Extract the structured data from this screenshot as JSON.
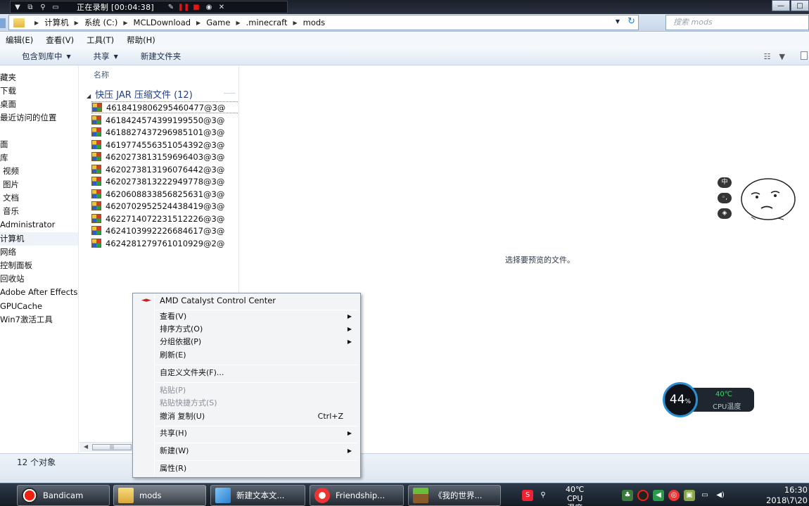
{
  "recorder": {
    "status_title": "正在录制 [00:04:38]"
  },
  "address_bar": {
    "crumbs": [
      "计算机",
      "系统 (C:)",
      "MCLDownload",
      "Game",
      ".minecraft",
      "mods"
    ],
    "search_placeholder": "搜索 mods"
  },
  "menu": {
    "items": [
      "编辑(E)",
      "查看(V)",
      "工具(T)",
      "帮助(H)"
    ]
  },
  "toolbar": {
    "include_library": "包含到库中",
    "share": "共享",
    "new_folder": "新建文件夹"
  },
  "nav": {
    "items": [
      {
        "label": "藏夹"
      },
      {
        "label": "下载"
      },
      {
        "label": "桌面"
      },
      {
        "label": "最近访问的位置"
      },
      {
        "label": ""
      },
      {
        "label": "面"
      },
      {
        "label": "库"
      },
      {
        "label": "视频"
      },
      {
        "label": "图片"
      },
      {
        "label": "文档"
      },
      {
        "label": "音乐"
      },
      {
        "label": "Administrator"
      },
      {
        "label": "计算机"
      },
      {
        "label": "网络"
      },
      {
        "label": "控制面板"
      },
      {
        "label": "回收站"
      },
      {
        "label": "Adobe After Effects"
      },
      {
        "label": "GPUCache"
      },
      {
        "label": "Win7激活工具"
      }
    ]
  },
  "file_list": {
    "column_name": "名称",
    "group_label": "快压 JAR 压缩文件 (12)",
    "files": [
      "4618419806295460477@3@",
      "4618424574399199550@3@",
      "4618827437296985101@3@",
      "4619774556351054392@3@",
      "4620273813159696403@3@",
      "4620273813196076442@3@",
      "4620273813222949778@3@",
      "4620608833856825631@3@",
      "4620702952524438419@3@",
      "4622714072231512226@3@",
      "4624103992226684617@3@",
      "4624281279761010929@2@"
    ]
  },
  "preview": {
    "message": "选择要预览的文件。"
  },
  "status": {
    "count": "12 个对象"
  },
  "context_menu": {
    "amd": "AMD Catalyst Control Center",
    "view": "查看(V)",
    "sort": "排序方式(O)",
    "group": "分组依据(P)",
    "refresh": "刷新(E)",
    "customize": "自定义文件夹(F)...",
    "paste": "粘贴(P)",
    "paste_shortcut": "粘贴快捷方式(S)",
    "undo": "撤消 复制(U)",
    "undo_shortcut": "Ctrl+Z",
    "share": "共享(H)",
    "new": "新建(W)",
    "properties": "属性(R)"
  },
  "ime": {
    "mode": "中"
  },
  "cpu_widget": {
    "usage_value": "44",
    "usage_unit": "%",
    "temperature": "40℃",
    "label": "CPU温度"
  },
  "taskbar": {
    "items": [
      "Bandicam",
      "mods",
      "新建文本文...",
      "Friendship...",
      "《我的世界..."
    ],
    "tray_temp": "40℃",
    "tray_temp_label": "CPU温度",
    "time": "16:30",
    "date": "2018\\7\\20"
  }
}
